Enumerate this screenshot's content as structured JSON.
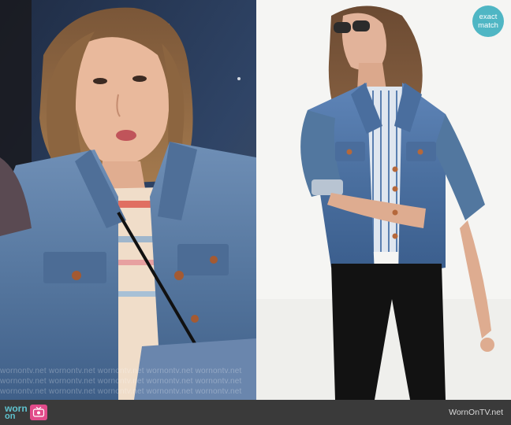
{
  "photos": {
    "left": {
      "subject": "show-still"
    },
    "right": {
      "subject": "product-photo"
    }
  },
  "watermark": {
    "text": "wornontv.net  wornontv.net  wornontv.net  wornontv.net  wornontv.net"
  },
  "badge": {
    "line1": "exact",
    "line2": "match",
    "color": "#4fb6c4"
  },
  "footer": {
    "logo_word1": "worn",
    "logo_word2": "on",
    "logo_icon": "tv-icon",
    "site": "WornOnTV.net",
    "background": "#3a3a3a",
    "accent": "#5fc3cf",
    "icon_color": "#e14b8a"
  }
}
